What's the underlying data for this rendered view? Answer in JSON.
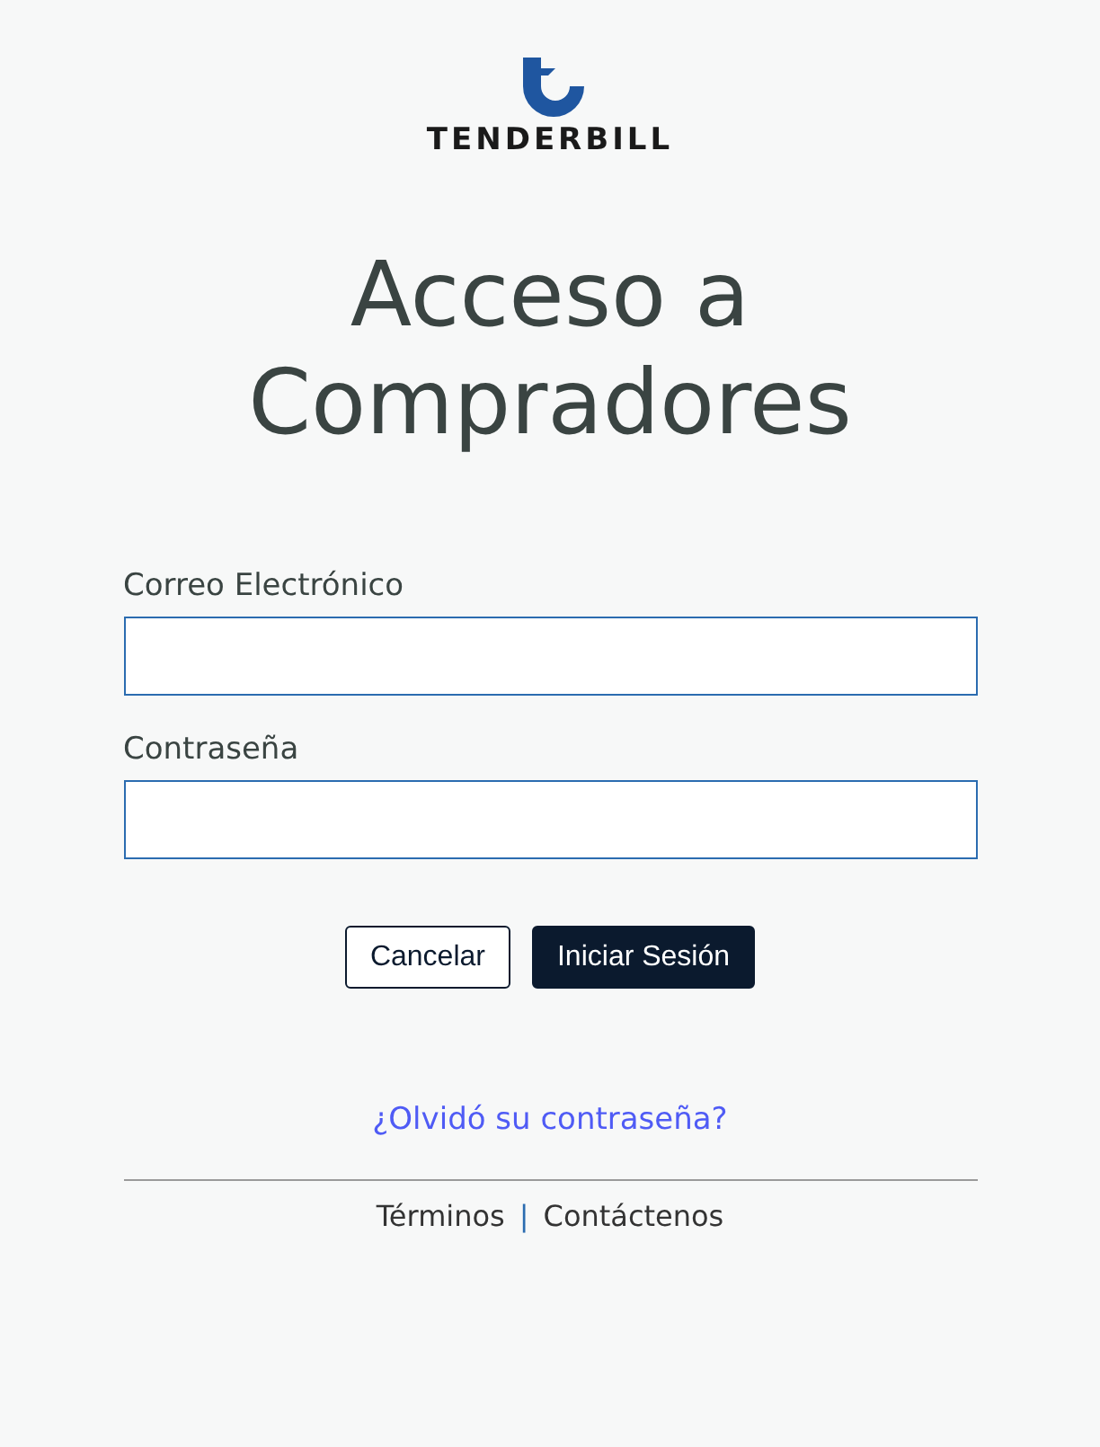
{
  "logo": {
    "text": "TENDERBILL"
  },
  "title": "Acceso a Compradores",
  "fields": [
    {
      "label": "Correo Electrónico"
    },
    {
      "label": "Contraseña"
    }
  ],
  "buttons": [
    {
      "label": "Cancelar",
      "kind": "secondary"
    },
    {
      "label": "Iniciar Sesión",
      "kind": "primary"
    }
  ],
  "forgot_link": "¿Olvidó su contraseña?",
  "footer": {
    "links": [
      "Términos",
      "Contáctenos"
    ],
    "separator": "|"
  }
}
